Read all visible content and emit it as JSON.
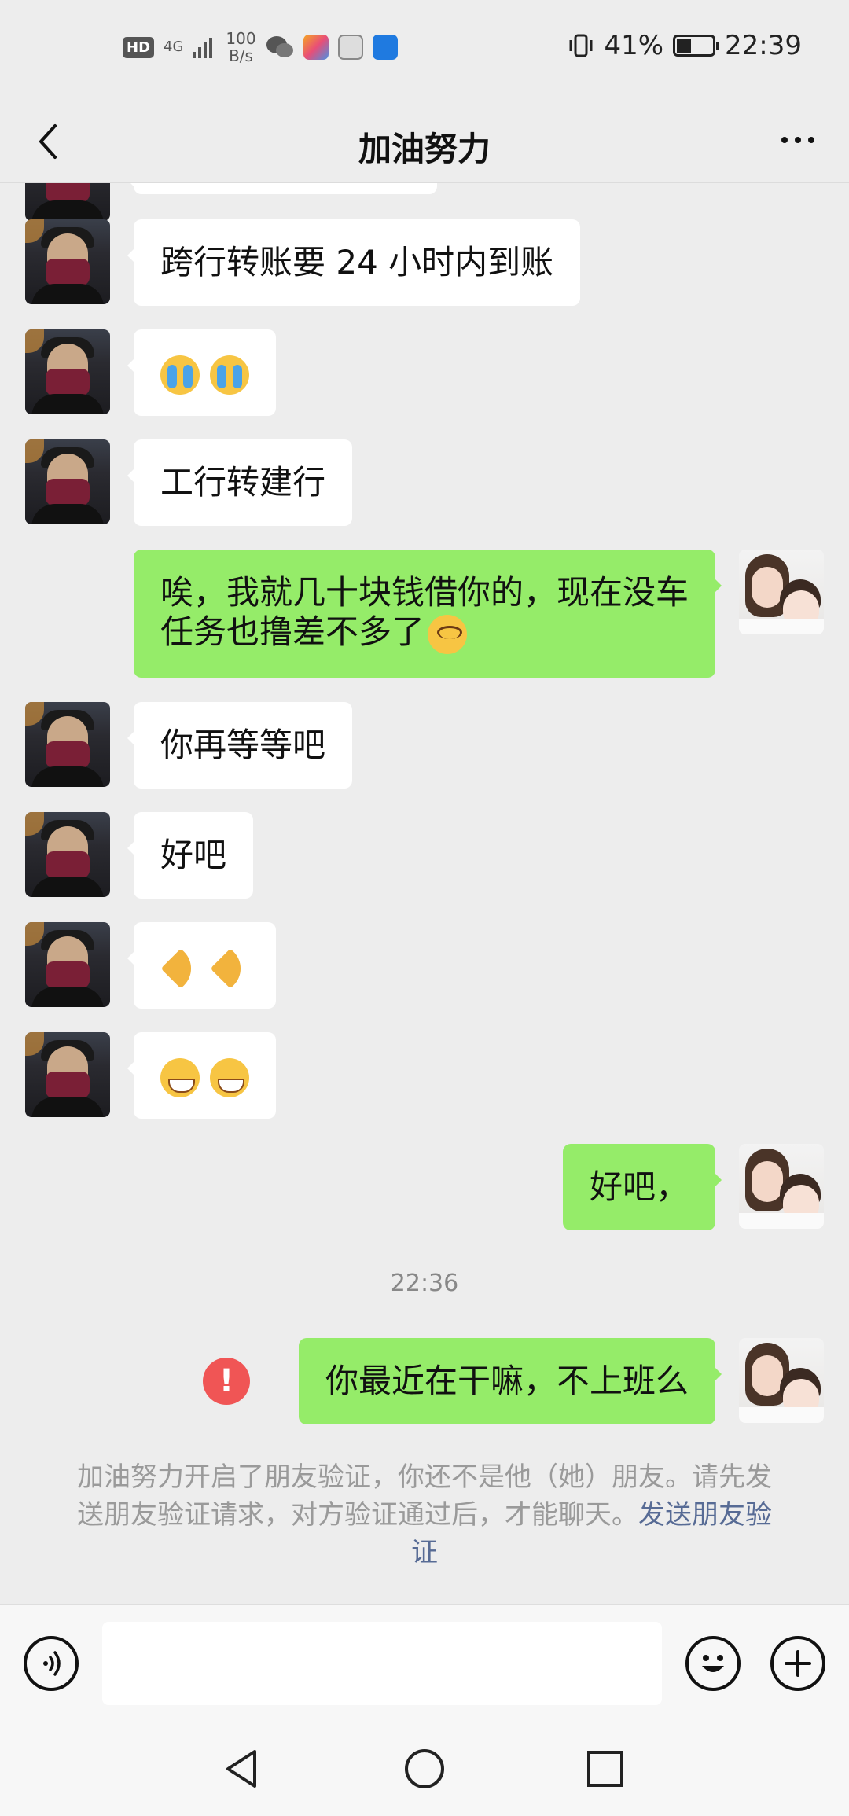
{
  "status_bar": {
    "hd_badge": "HD",
    "net": "4G",
    "speed_value": "100",
    "speed_unit": "B/s",
    "battery_percent": "41%",
    "battery_level": 0.41,
    "time": "22:39"
  },
  "header": {
    "title": "加油努力"
  },
  "messages": [
    {
      "side": "in",
      "text": "跨行转账要 24 小时内到账"
    },
    {
      "side": "in",
      "emoji": "loudly-crying-face x2"
    },
    {
      "side": "in",
      "text": "工行转建行"
    },
    {
      "side": "out",
      "text": "唉，我就几十块钱借你的，现在没车任务也撸差不多了"
    },
    {
      "side": "in",
      "text": "你再等等吧"
    },
    {
      "side": "in",
      "text": "好吧"
    },
    {
      "side": "in",
      "emoji": "folded-hands x2"
    },
    {
      "side": "in",
      "emoji": "grinning-face x2"
    },
    {
      "side": "out",
      "text": "好吧，"
    },
    {
      "side": "out",
      "text": "你最近在干嘛，不上班么",
      "failed": true
    }
  ],
  "timestamp": "22:36",
  "error_mark": "!",
  "notice": {
    "text": "加油努力开启了朋友验证，你还不是他（她）朋友。请先发送朋友验证请求，对方验证通过后，才能聊天。",
    "link": "发送朋友验证"
  },
  "colors": {
    "chat_bg": "#ededed",
    "out_bubble": "#95ec69",
    "in_bubble": "#ffffff",
    "link": "#576b95",
    "error": "#f05555"
  }
}
